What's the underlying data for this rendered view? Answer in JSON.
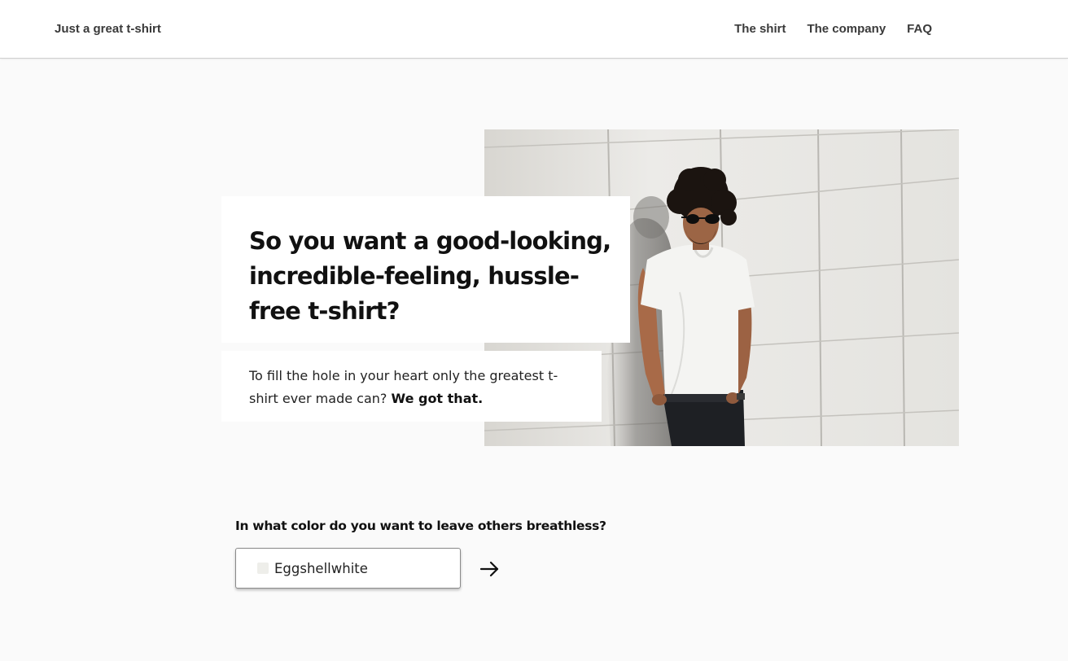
{
  "header": {
    "brand": "Just a great t-shirt",
    "nav": [
      {
        "label": "The shirt"
      },
      {
        "label": "The company"
      },
      {
        "label": "FAQ"
      }
    ]
  },
  "hero": {
    "headline": "So you want a good-looking, incredible-feeling, hussle-free t-shirt?",
    "sub_text": "To fill the hole in your heart only the greatest t-shirt ever made can?",
    "sub_strong": "We got that.",
    "photo_icon": "person-in-white-tshirt-photo"
  },
  "color_picker": {
    "question": "In what color do you want to leave others breathless?",
    "selected": "Eggshellwhite",
    "swatch_color": "#eeeeea",
    "next_icon": "arrow-right-icon"
  },
  "colors": {
    "page_bg": "#fafafa",
    "card_bg": "#ffffff",
    "text": "#111111"
  }
}
